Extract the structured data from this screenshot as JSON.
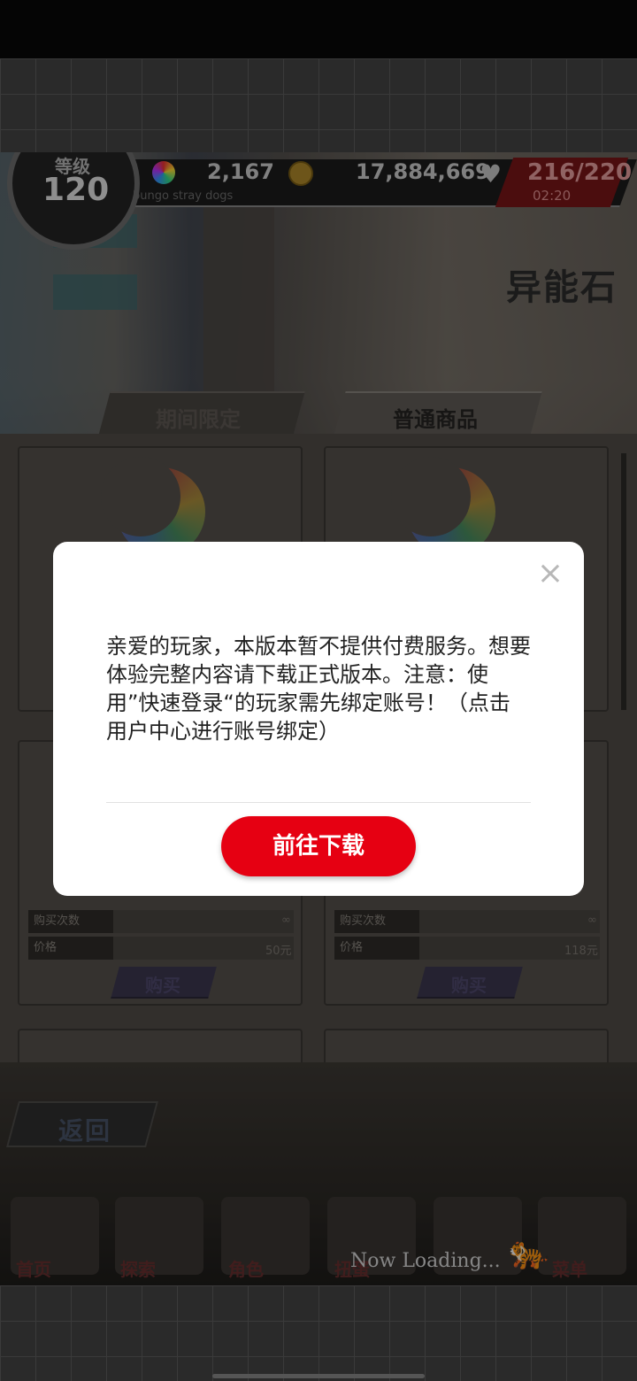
{
  "hud": {
    "level_label": "等级",
    "level_value": "120",
    "stones": "2,167",
    "coins": "17,884,669",
    "stamina": "216/220",
    "stamina_timer": "02:20",
    "subtext": "bungo stray dogs"
  },
  "page": {
    "title": "异能石"
  },
  "tabs": [
    {
      "label": "期间限定",
      "active": false
    },
    {
      "label": "普通商品",
      "active": true
    }
  ],
  "cards": [
    {
      "purchase_label": "购买次数",
      "purchase_value": "∞",
      "price_label": "价格",
      "price_value": "50元",
      "buy_label": "购买"
    },
    {
      "purchase_label": "购买次数",
      "purchase_value": "∞",
      "price_label": "价格",
      "price_value": "118元",
      "buy_label": "购买"
    }
  ],
  "nav": {
    "back_label": "返回",
    "items": [
      {
        "label": "首页",
        "icon": "bungo-logo-icon"
      },
      {
        "label": "探索",
        "icon": "dog-icon"
      },
      {
        "label": "角色",
        "icon": "people-icon"
      },
      {
        "label": "扭蛋",
        "icon": "book-icon"
      },
      {
        "label": "",
        "icon": "moon-stone-icon"
      },
      {
        "label": "菜单",
        "icon": "gear-icon"
      }
    ],
    "loading_text": "Now Loading..."
  },
  "modal": {
    "message": "亲爱的玩家，本版本暂不提供付费服务。想要体验完整内容请下载正式版本。注意：使用”快速登录“的玩家需先绑定账号！（点击用户中心进行账号绑定）",
    "button_label": "前往下载",
    "close_icon": "close-icon",
    "accent_color": "#e60012"
  }
}
